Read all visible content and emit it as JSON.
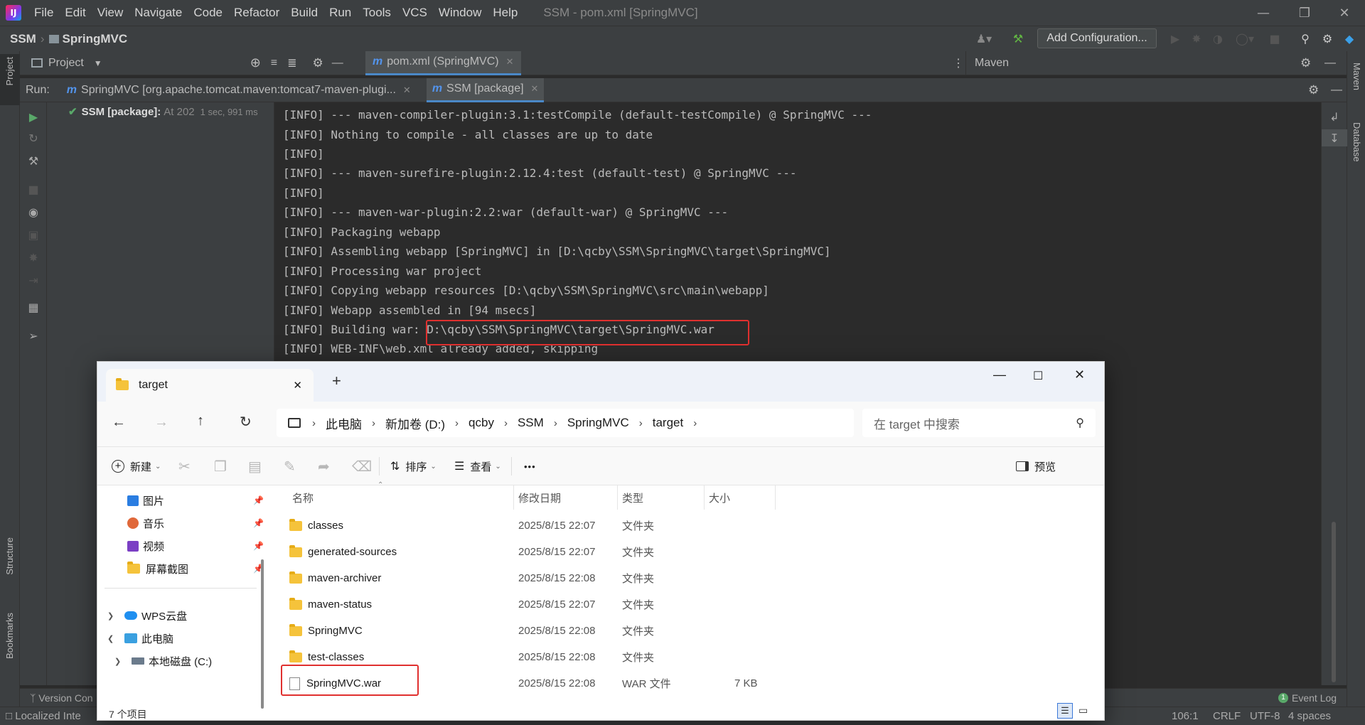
{
  "ide": {
    "logo_text": "IJ",
    "menu": [
      "File",
      "Edit",
      "View",
      "Navigate",
      "Code",
      "Refactor",
      "Build",
      "Run",
      "Tools",
      "VCS",
      "Window",
      "Help"
    ],
    "window_title": "SSM - pom.xml [SpringMVC]",
    "breadcrumb": {
      "root": "SSM",
      "module": "SpringMVC"
    },
    "add_configuration": "Add Configuration...",
    "project_panel": "Project",
    "editor_tab": "pom.xml (SpringMVC)",
    "maven_panel": "Maven",
    "run_label": "Run:",
    "run_tabs": [
      {
        "label": "SpringMVC [org.apache.tomcat.maven:tomcat7-maven-plugi...",
        "active": false
      },
      {
        "label": "SSM [package]",
        "active": true
      }
    ],
    "run_tree": {
      "name": "SSM [package]:",
      "detail": "At 202",
      "duration": "1 sec, 991 ms"
    },
    "console_lines": [
      "[INFO] --- maven-compiler-plugin:3.1:testCompile (default-testCompile) @ SpringMVC ---",
      "[INFO] Nothing to compile - all classes are up to date",
      "[INFO]",
      "[INFO] --- maven-surefire-plugin:2.12.4:test (default-test) @ SpringMVC ---",
      "[INFO]",
      "[INFO] --- maven-war-plugin:2.2:war (default-war) @ SpringMVC ---",
      "[INFO] Packaging webapp",
      "[INFO] Assembling webapp [SpringMVC] in [D:\\qcby\\SSM\\SpringMVC\\target\\SpringMVC]",
      "[INFO] Processing war project",
      "[INFO] Copying webapp resources [D:\\qcby\\SSM\\SpringMVC\\src\\main\\webapp]",
      "[INFO] Webapp assembled in [94 msecs]",
      "[INFO] Building war: D:\\qcby\\SSM\\SpringMVC\\target\\SpringMVC.war",
      "[INFO] WEB-INF\\web.xml already added, skipping"
    ],
    "left_tabs": {
      "project": "Project",
      "structure": "Structure",
      "bookmarks": "Bookmarks"
    },
    "right_tabs": {
      "maven": "Maven",
      "database": "Database"
    },
    "bottom_tabs": {
      "version_control": "Version Con",
      "event_log": "Event Log"
    },
    "status": {
      "left": "Localized Inte",
      "position": "106:1",
      "line_sep": "CRLF",
      "encoding": "UTF-8",
      "indent": "4 spaces"
    }
  },
  "explorer": {
    "tab_title": "target",
    "address": [
      "此电脑",
      "新加卷 (D:)",
      "qcby",
      "SSM",
      "SpringMVC",
      "target"
    ],
    "search_placeholder": "在 target 中搜索",
    "commands": {
      "new": "新建",
      "sort": "排序",
      "view": "查看",
      "more": "•••",
      "preview": "预览"
    },
    "nav": [
      {
        "label": "图片",
        "pinned": true,
        "icon": "pictures-icon"
      },
      {
        "label": "音乐",
        "pinned": true,
        "icon": "music-icon"
      },
      {
        "label": "视频",
        "pinned": true,
        "icon": "videos-icon"
      },
      {
        "label": "屏幕截图",
        "pinned": true,
        "icon": "folder-icon"
      },
      {
        "label": "WPS云盘",
        "pinned": false,
        "icon": "cloud-icon"
      },
      {
        "label": "此电脑",
        "pinned": false,
        "icon": "pc-icon"
      },
      {
        "label": "本地磁盘 (C:)",
        "pinned": false,
        "icon": "drive-icon"
      }
    ],
    "columns": [
      "名称",
      "修改日期",
      "类型",
      "大小"
    ],
    "rows": [
      {
        "name": "classes",
        "date": "2025/8/15 22:07",
        "type": "文件夹",
        "size": "",
        "kind": "folder"
      },
      {
        "name": "generated-sources",
        "date": "2025/8/15 22:07",
        "type": "文件夹",
        "size": "",
        "kind": "folder"
      },
      {
        "name": "maven-archiver",
        "date": "2025/8/15 22:08",
        "type": "文件夹",
        "size": "",
        "kind": "folder"
      },
      {
        "name": "maven-status",
        "date": "2025/8/15 22:07",
        "type": "文件夹",
        "size": "",
        "kind": "folder"
      },
      {
        "name": "SpringMVC",
        "date": "2025/8/15 22:08",
        "type": "文件夹",
        "size": "",
        "kind": "folder"
      },
      {
        "name": "test-classes",
        "date": "2025/8/15 22:08",
        "type": "文件夹",
        "size": "",
        "kind": "folder"
      },
      {
        "name": "SpringMVC.war",
        "date": "2025/8/15 22:08",
        "type": "WAR 文件",
        "size": "7 KB",
        "kind": "file"
      }
    ],
    "status": "7 个项目"
  },
  "colors": {
    "highlight": "#e0302f",
    "ide_bg": "#2b2b2b",
    "ide_panel": "#3c3f41",
    "accent": "#4a88c7"
  }
}
